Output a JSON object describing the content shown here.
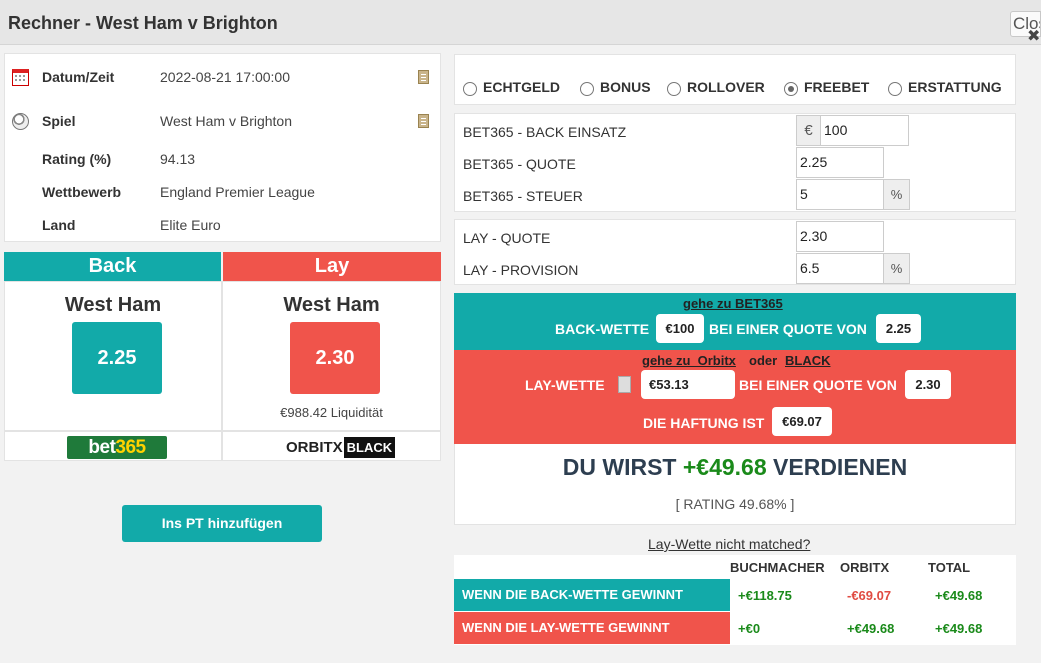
{
  "window": {
    "title": "Rechner - West Ham v Brighton",
    "close_label": "Close",
    "close_icon": "close-icon"
  },
  "info": {
    "rows": [
      {
        "label": "Datum/Zeit",
        "value": "2022-08-21 17:00:00",
        "icon": "calendar-icon",
        "copyable": true
      },
      {
        "label": "Spiel",
        "value": "West Ham v Brighton",
        "icon": "football-icon",
        "copyable": true
      },
      {
        "label": "Rating (%)",
        "value": "94.13"
      },
      {
        "label": "Wettbewerb",
        "value": "England Premier League"
      },
      {
        "label": "Land",
        "value": "Elite Euro"
      }
    ]
  },
  "back": {
    "header": "Back",
    "team": "West Ham",
    "odds": "2.25",
    "bookmaker_logo_text_a": "bet",
    "bookmaker_logo_text_b": "365"
  },
  "lay": {
    "header": "Lay",
    "team": "West Ham",
    "odds": "2.30",
    "liquidity": "€988.42 Liquidität",
    "exchange_logo_a": "ORBITX",
    "exchange_logo_b": "BLACK"
  },
  "add_pt_button": "Ins PT hinzufügen",
  "bet_types": {
    "options": [
      "ECHTGELD",
      "BONUS",
      "ROLLOVER",
      "FREEBET",
      "ERSTATTUNG"
    ],
    "selected": "FREEBET"
  },
  "fields": {
    "back_stake": {
      "label": "BET365 - BACK EINSATZ",
      "prefix": "€",
      "value": "100"
    },
    "back_odds": {
      "label": "BET365 - QUOTE",
      "value": "2.25"
    },
    "back_tax": {
      "label": "BET365 - STEUER",
      "value": "5",
      "suffix": "%"
    },
    "lay_odds": {
      "label": "LAY - QUOTE",
      "value": "2.30"
    },
    "lay_commission": {
      "label": "LAY - PROVISION",
      "value": "6.5",
      "suffix": "%"
    }
  },
  "instructions": {
    "back_link": "gehe zu BET365",
    "back_label": "BACK-WETTE",
    "back_stake": "€100",
    "at_odds_label": "BEI EINER QUOTE VON",
    "back_odds": "2.25",
    "lay_link_prefix": "gehe zu  Orbitx",
    "lay_link_or": "oder",
    "lay_link_black": "BLACK",
    "lay_label": "LAY-WETTE",
    "lay_stake": "€53.13",
    "lay_odds": "2.30",
    "liability_label": "DIE HAFTUNG IST",
    "liability": "€69.07"
  },
  "result": {
    "prefix": "DU WIRST",
    "amount": "+€49.68",
    "suffix": "VERDIENEN",
    "rating": "[ RATING 49.68% ]"
  },
  "not_matched_link": "Lay-Wette nicht matched?",
  "summary": {
    "headers": [
      "BUCHMACHER",
      "ORBITX",
      "TOTAL"
    ],
    "rows": [
      {
        "label": "WENN DIE BACK-WETTE GEWINNT",
        "bookmaker": "+€118.75",
        "orbitx": "-€69.07",
        "total": "+€49.68"
      },
      {
        "label": "WENN DIE LAY-WETTE GEWINNT",
        "bookmaker": "+€0",
        "orbitx": "+€49.68",
        "total": "+€49.68"
      }
    ]
  },
  "colors": {
    "teal": "#12aaa9",
    "red": "#f0544b",
    "green": "#1a8a1a"
  }
}
